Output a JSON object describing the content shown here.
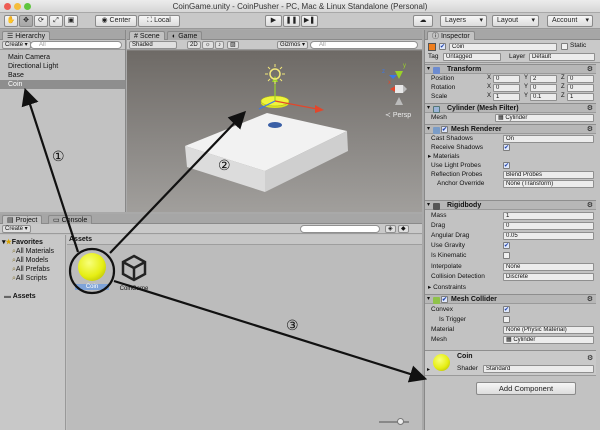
{
  "window": {
    "title": "CoinGame.unity - CoinPusher - PC, Mac & Linux Standalone (Personal)"
  },
  "toolbar": {
    "pivot": "Center",
    "space": "Local",
    "layers": "Layers",
    "layout": "Layout",
    "account": "Account",
    "tool_icons": [
      "hand-icon",
      "move-icon",
      "rotate-icon",
      "scale-icon",
      "rect-icon"
    ],
    "play_icons": [
      "play-icon",
      "pause-icon",
      "step-icon"
    ]
  },
  "hierarchy": {
    "tab": "Hierarchy",
    "create": "Create",
    "search": "All",
    "items": [
      "Main Camera",
      "Directional Light",
      "Base",
      "Coin"
    ],
    "selected_index": 3
  },
  "scene": {
    "tab_scene": "Scene",
    "tab_game": "Game",
    "shading": "Shaded",
    "mode2d": "2D",
    "gizmos": "Gizmos",
    "search": "All",
    "persp": "Persp",
    "axis_x": "x",
    "axis_y": "y",
    "axis_z": "z"
  },
  "project": {
    "tab_project": "Project",
    "tab_console": "Console",
    "create": "Create",
    "favorites_label": "Favorites",
    "favorites": [
      "All Materials",
      "All Models",
      "All Prefabs",
      "All Scripts"
    ],
    "assets_root": "Assets",
    "breadcrumb": "Assets",
    "assets": [
      {
        "name": "Coin",
        "kind": "material"
      },
      {
        "name": "CoinGame",
        "kind": "unity-scene"
      }
    ]
  },
  "inspector": {
    "tab": "Inspector",
    "object_name": "Coin",
    "static_label": "Static",
    "tag_label": "Tag",
    "tag_value": "Untagged",
    "layer_label": "Layer",
    "layer_value": "Default",
    "transform": {
      "title": "Transform",
      "rows": [
        {
          "label": "Position",
          "x": "0",
          "y": "2",
          "z": "0"
        },
        {
          "label": "Rotation",
          "x": "0",
          "y": "0",
          "z": "0"
        },
        {
          "label": "Scale",
          "x": "1",
          "y": "0.1",
          "z": "1"
        }
      ]
    },
    "mesh_filter": {
      "title": "Cylinder (Mesh Filter)",
      "mesh_label": "Mesh",
      "mesh_value": "Cylinder"
    },
    "mesh_renderer": {
      "title": "Mesh Renderer",
      "cast_shadows_label": "Cast Shadows",
      "cast_shadows_value": "On",
      "receive_shadows_label": "Receive Shadows",
      "materials_label": "Materials",
      "light_probes_label": "Use Light Probes",
      "reflection_label": "Reflection Probes",
      "reflection_value": "Blend Probes",
      "anchor_label": "Anchor Override",
      "anchor_value": "None (Transform)"
    },
    "rigidbody": {
      "title": "Rigidbody",
      "mass_label": "Mass",
      "mass_value": "1",
      "drag_label": "Drag",
      "drag_value": "0",
      "angular_label": "Angular Drag",
      "angular_value": "0.05",
      "gravity_label": "Use Gravity",
      "kinematic_label": "Is Kinematic",
      "interpolate_label": "Interpolate",
      "interpolate_value": "None",
      "collision_label": "Collision Detection",
      "collision_value": "Discrete",
      "constraints_label": "Constraints"
    },
    "mesh_collider": {
      "title": "Mesh Collider",
      "convex_label": "Convex",
      "trigger_label": "Is Trigger",
      "material_label": "Material",
      "material_value": "None (Physic Material)",
      "mesh_label": "Mesh",
      "mesh_value": "Cylinder"
    },
    "material": {
      "name": "Coin",
      "shader_label": "Shader",
      "shader_value": "Standard"
    },
    "add_component": "Add Component"
  },
  "annotations": {
    "one": "①",
    "two": "②",
    "three": "③"
  },
  "colors": {
    "coin_yellow": "#e6ee14",
    "selection": "#8e8e8e",
    "gizmo_x": "#e2462b",
    "gizmo_y": "#9bd328",
    "gizmo_z": "#3b77e8"
  }
}
